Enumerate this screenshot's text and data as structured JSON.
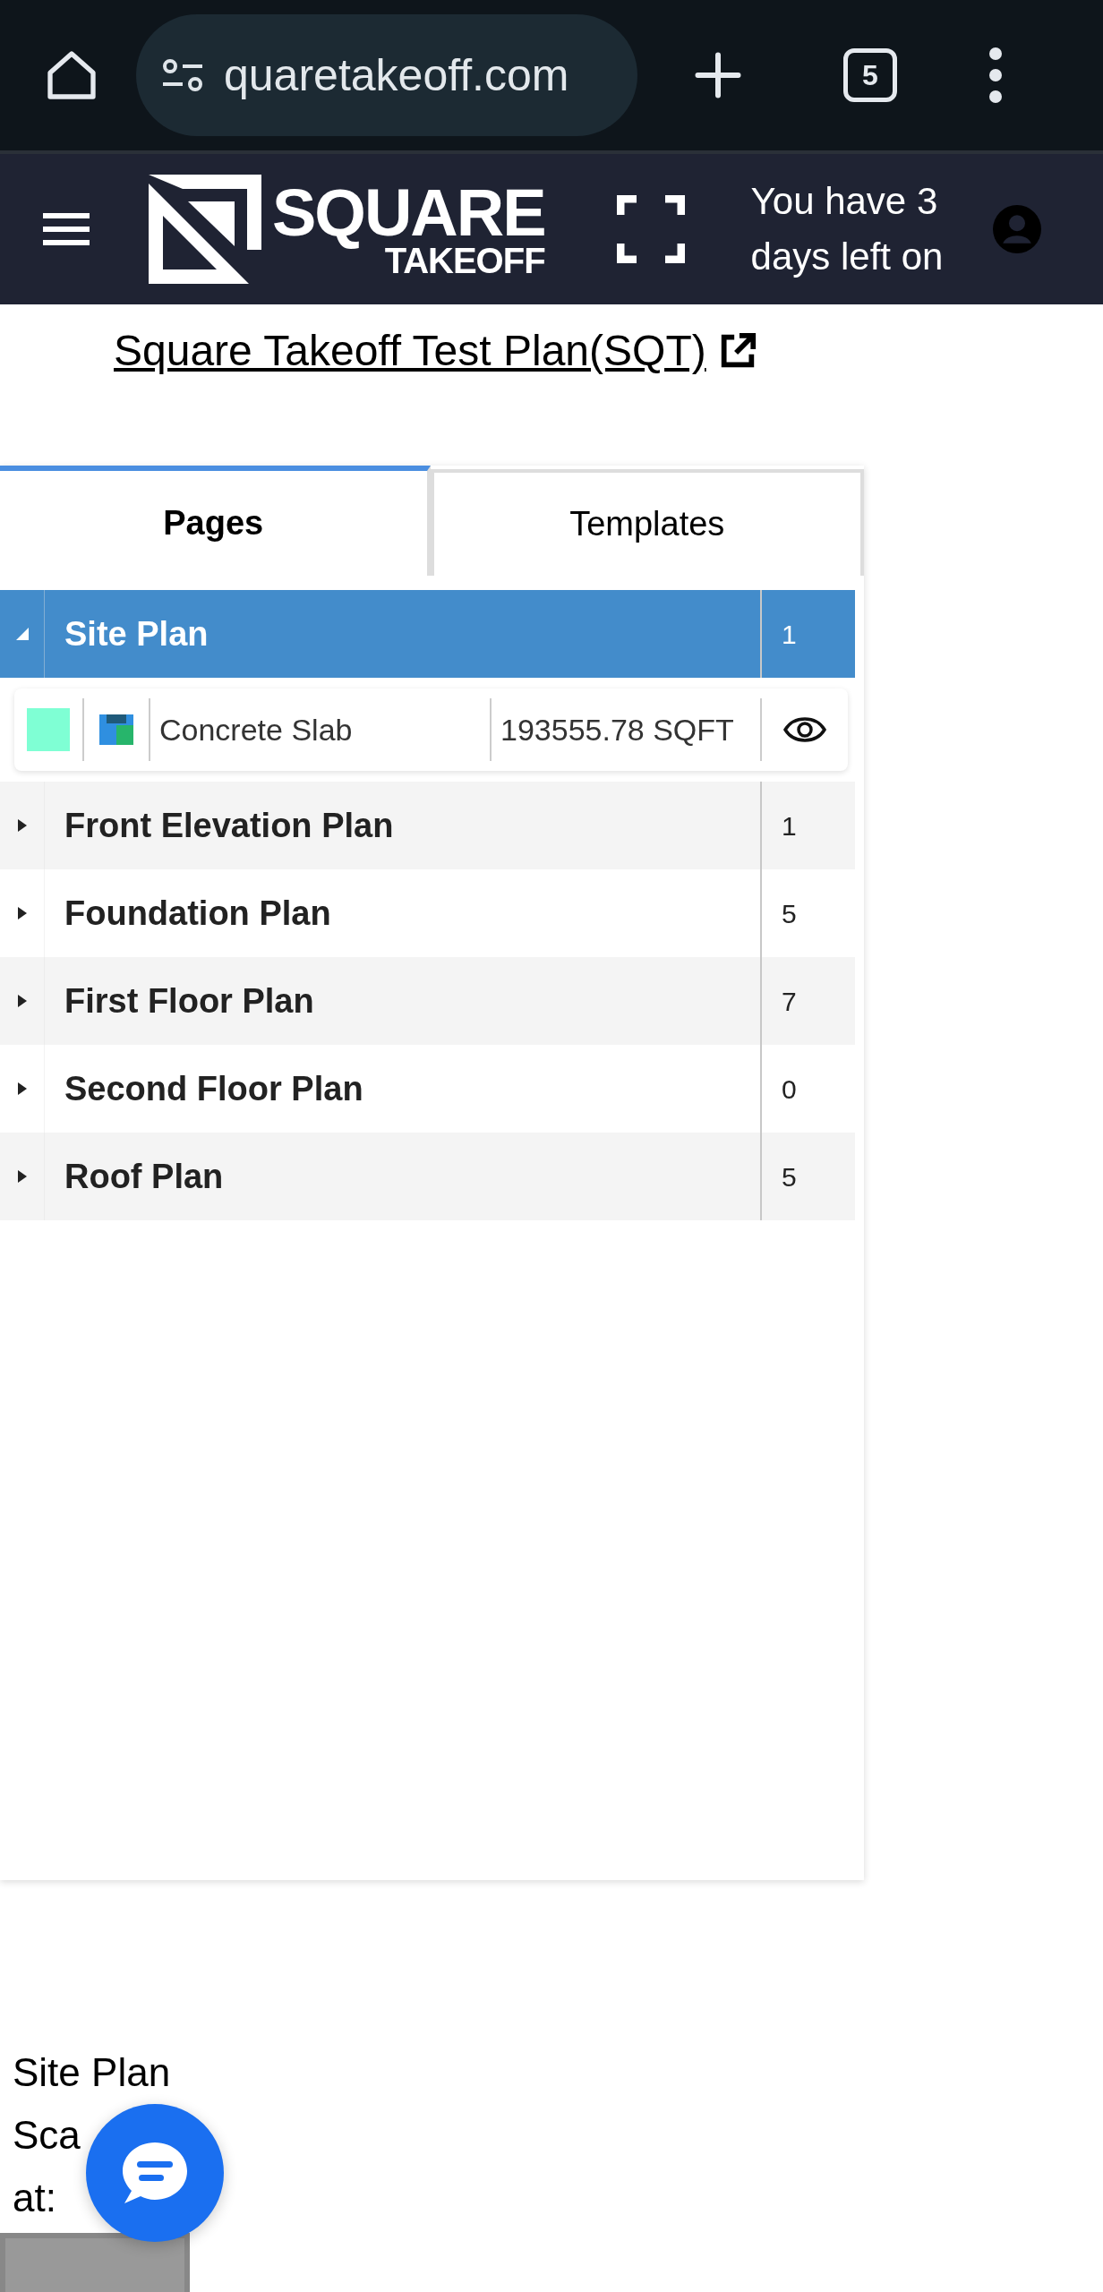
{
  "browser": {
    "url": "quaretakeoff.com",
    "tab_count": "5"
  },
  "header": {
    "logo_top": "SQUARE",
    "logo_bottom": "TAKEOFF",
    "trial_notice": "You have 3 days left on"
  },
  "plan_title": "Square Takeoff Test Plan(SQT)",
  "tabs": [
    {
      "label": "Pages",
      "selected": true
    },
    {
      "label": "Templates",
      "selected": false
    }
  ],
  "pages": [
    {
      "name": "Site Plan",
      "count": "1",
      "selected": true,
      "expanded": true,
      "children": [
        {
          "name": "Concrete Slab",
          "quantity": "193555.78 SQFT",
          "color": "#7fffd4"
        }
      ]
    },
    {
      "name": "Front Elevation Plan",
      "count": "1",
      "selected": false,
      "expanded": false
    },
    {
      "name": "Foundation Plan",
      "count": "5",
      "selected": false,
      "expanded": false
    },
    {
      "name": "First Floor Plan",
      "count": "7",
      "selected": false,
      "expanded": false
    },
    {
      "name": "Second Floor Plan",
      "count": "0",
      "selected": false,
      "expanded": false
    },
    {
      "name": "Roof Plan",
      "count": "5",
      "selected": false,
      "expanded": false
    }
  ],
  "page_info": [
    "Site Plan",
    "Sca",
    "at:"
  ]
}
